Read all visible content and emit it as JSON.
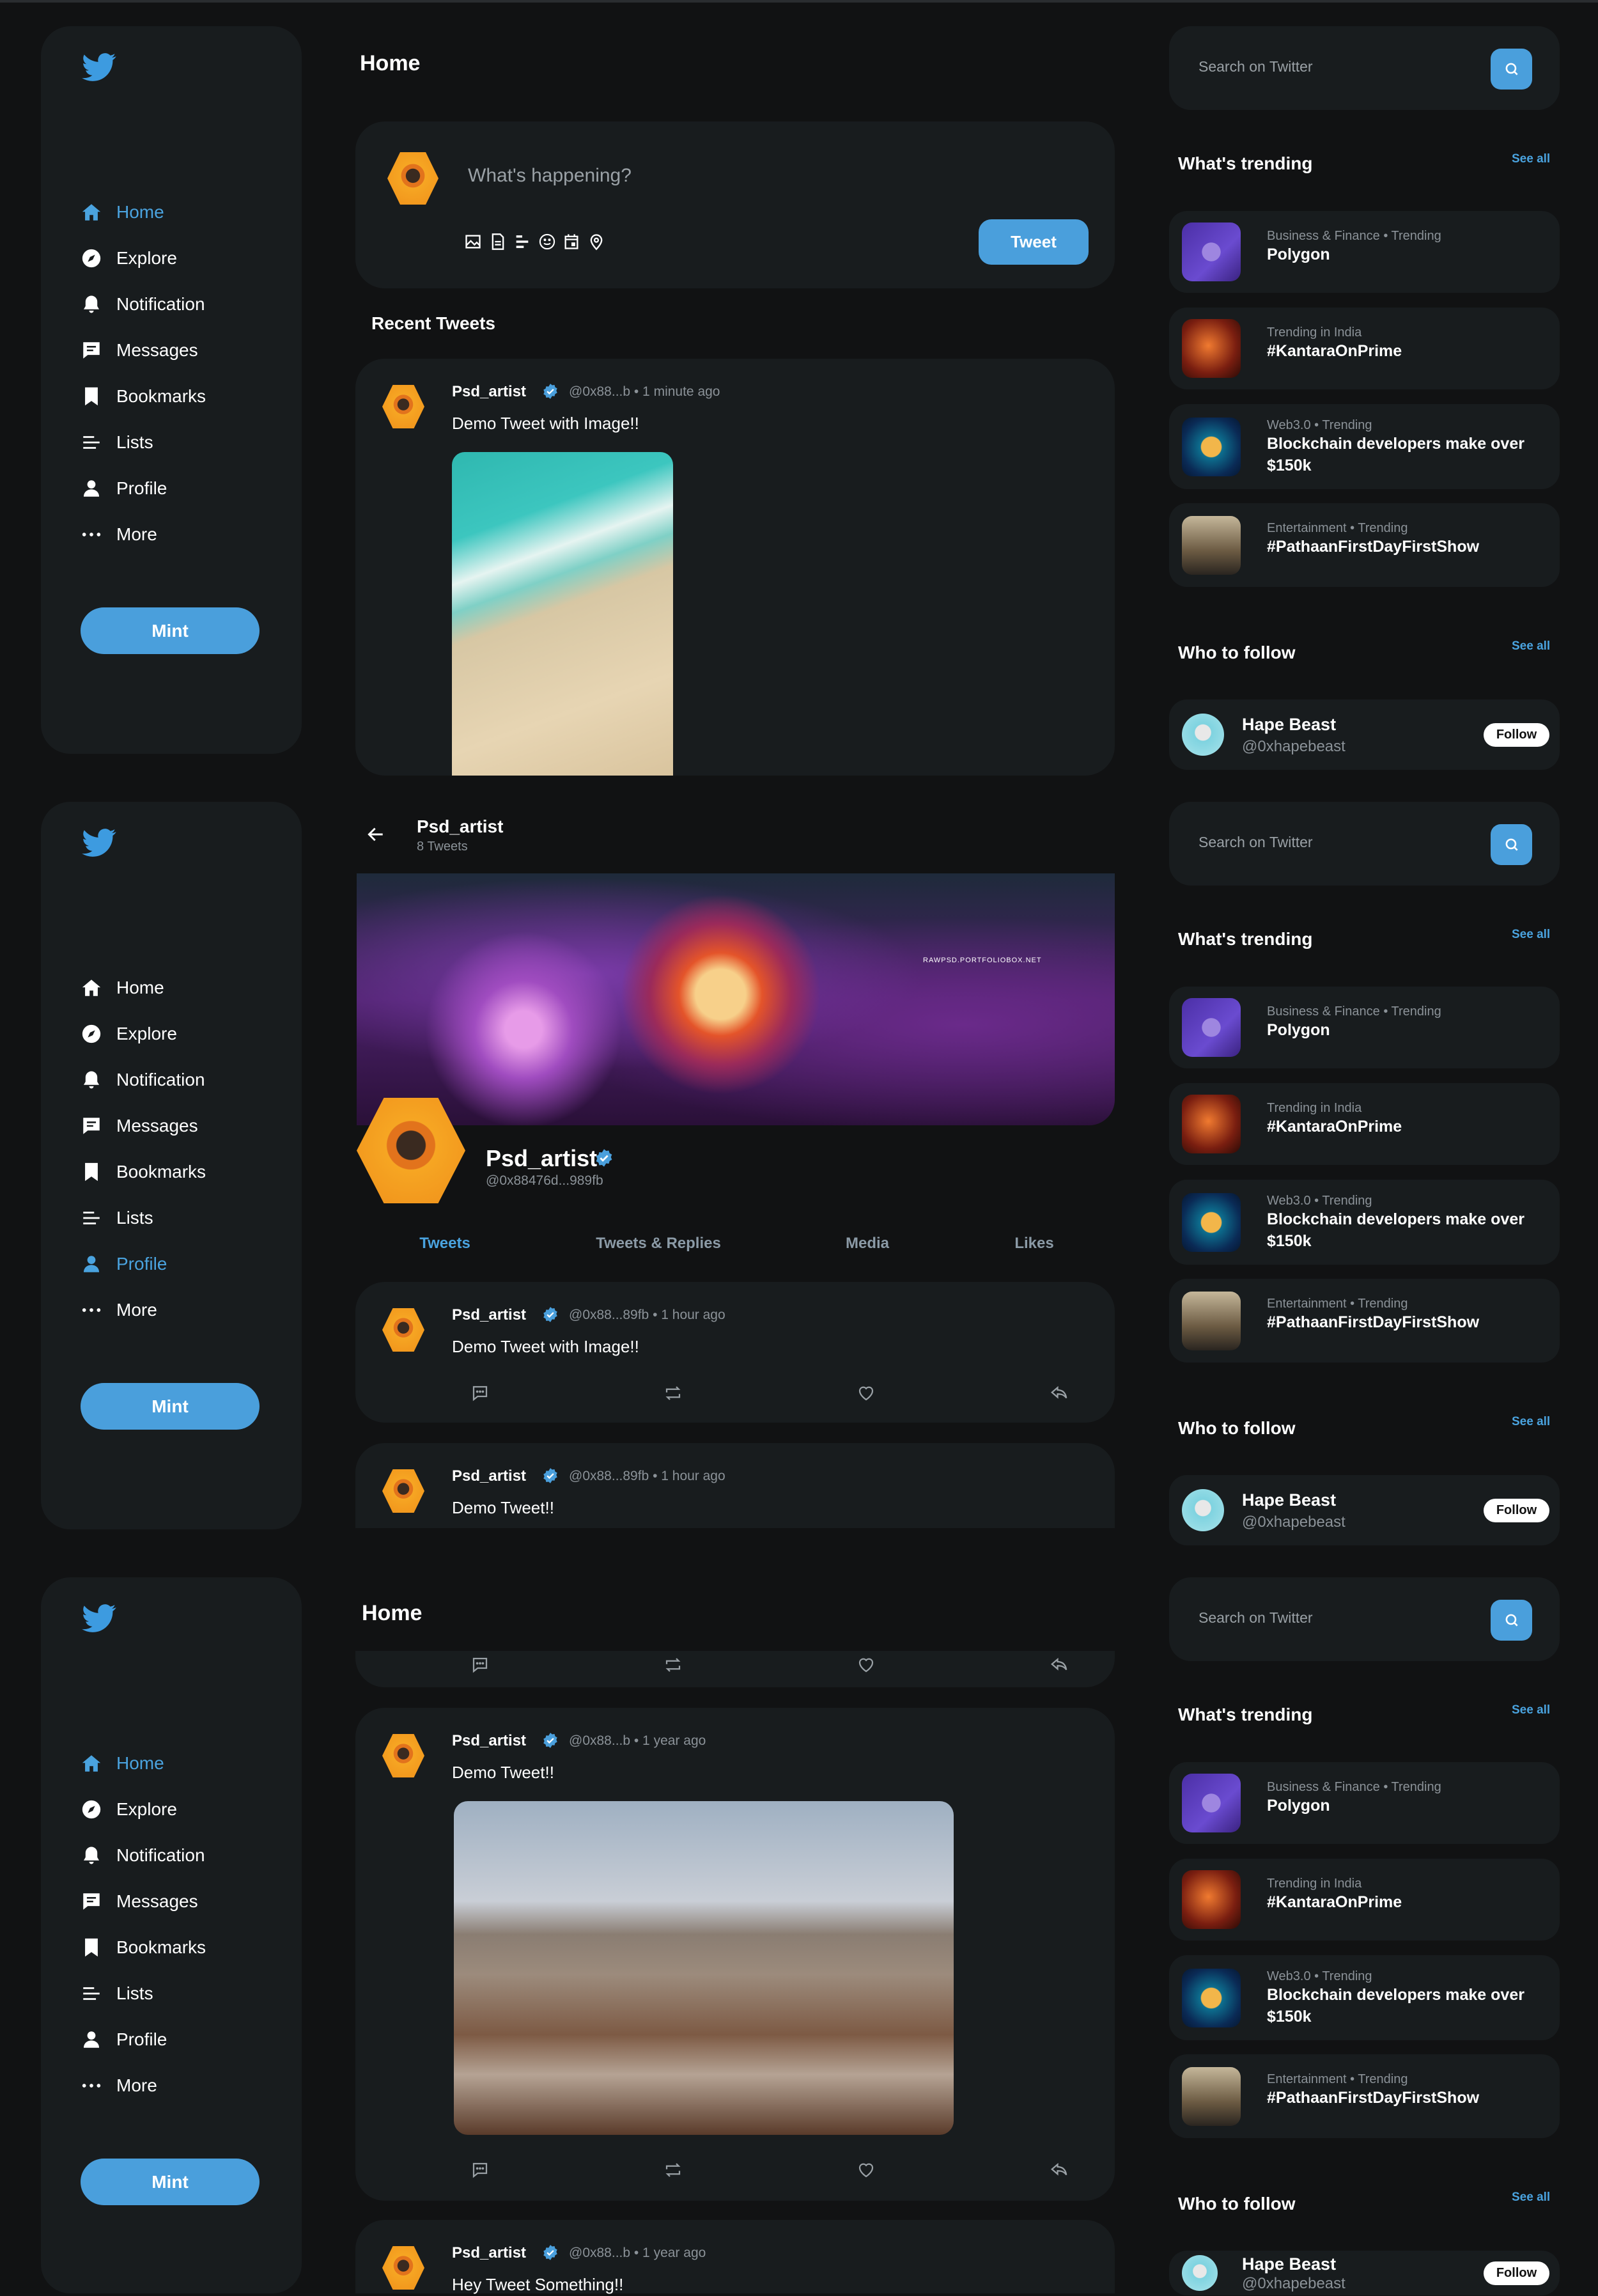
{
  "app": {
    "logo_icon": "twitter-bird-icon",
    "accent": "#4a9fdc"
  },
  "sidebar": {
    "items": [
      {
        "label": "Home",
        "icon": "home-icon"
      },
      {
        "label": "Explore",
        "icon": "compass-icon"
      },
      {
        "label": "Notification",
        "icon": "bell-icon"
      },
      {
        "label": "Messages",
        "icon": "message-icon"
      },
      {
        "label": "Bookmarks",
        "icon": "bookmark-icon"
      },
      {
        "label": "Lists",
        "icon": "list-icon"
      },
      {
        "label": "Profile",
        "icon": "user-icon"
      },
      {
        "label": "More",
        "icon": "more-icon"
      }
    ],
    "mint_label": "Mint"
  },
  "right": {
    "search_placeholder": "Search on Twitter",
    "trending_title": "What's trending",
    "see_all": "See all",
    "trends": [
      {
        "category": "Business & Finance • Trending",
        "title": "Polygon"
      },
      {
        "category": "Trending in India",
        "title": "#KantaraOnPrime"
      },
      {
        "category": "Web3.0 • Trending",
        "title": "Blockchain developers make over $150k"
      },
      {
        "category": "Entertainment • Trending",
        "title": "#PathaanFirstDayFirstShow"
      }
    ],
    "follow_title": "Who to follow",
    "follow": [
      {
        "name": "Hape Beast",
        "handle": "@0xhapebeast",
        "button": "Follow"
      }
    ]
  },
  "screens": [
    {
      "active_nav": 0,
      "title": "Home",
      "compose": {
        "placeholder": "What's happening?",
        "tweet_label": "Tweet"
      },
      "section_title": "Recent Tweets",
      "tweets": [
        {
          "name": "Psd_artist",
          "meta": "@0x88...b • 1 minute ago",
          "text": "Demo Tweet with Image!!"
        }
      ]
    },
    {
      "active_nav": 6,
      "profile": {
        "header_name": "Psd_artist",
        "tweet_count": "8 Tweets",
        "name": "Psd_artist",
        "handle": "@0x88476d...989fb",
        "banner_watermark": "RAWPSD.PORTFOLIOBOX.NET"
      },
      "tabs": [
        "Tweets",
        "Tweets & Replies",
        "Media",
        "Likes"
      ],
      "active_tab": 0,
      "tweets": [
        {
          "name": "Psd_artist",
          "meta": "@0x88...89fb • 1 hour ago",
          "text": "Demo Tweet with Image!!"
        },
        {
          "name": "Psd_artist",
          "meta": "@0x88...89fb • 1 hour ago",
          "text": "Demo Tweet!!"
        }
      ]
    },
    {
      "active_nav": 0,
      "title": "Home",
      "tweets": [
        {
          "name": "Psd_artist",
          "meta": "@0x88...b • 1 year ago",
          "text": "Demo Tweet!!"
        },
        {
          "name": "Psd_artist",
          "meta": "@0x88...b • 1 year ago",
          "text": "Hey Tweet Something!!"
        }
      ]
    }
  ]
}
